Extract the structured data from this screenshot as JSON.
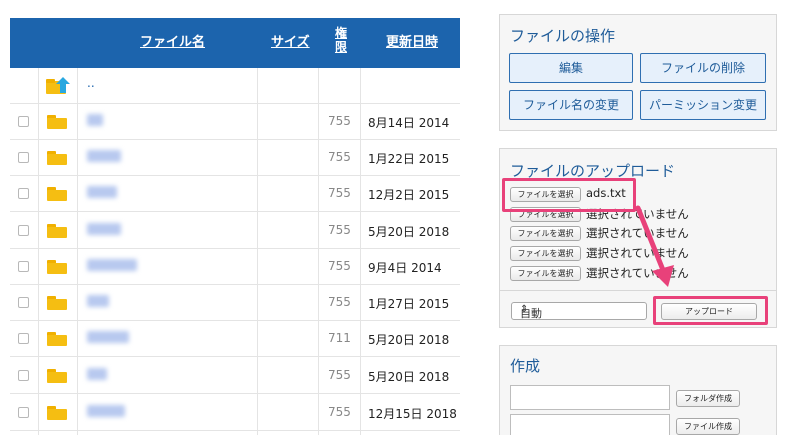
{
  "table": {
    "headers": {
      "name": "ファイル名",
      "size": "サイズ",
      "perm": "権限",
      "date": "更新日時"
    },
    "up_row_label": "..",
    "rows": [
      {
        "perm": "755",
        "date": "8月14日 2014"
      },
      {
        "perm": "755",
        "date": "1月22日 2015"
      },
      {
        "perm": "755",
        "date": "12月2日 2015"
      },
      {
        "perm": "755",
        "date": "5月20日 2018"
      },
      {
        "perm": "755",
        "date": "9月4日 2014"
      },
      {
        "perm": "755",
        "date": "1月27日 2015"
      },
      {
        "perm": "711",
        "date": "5月20日 2018"
      },
      {
        "perm": "755",
        "date": "5月20日 2018"
      },
      {
        "perm": "755",
        "date": "12月15日 2018"
      }
    ]
  },
  "file_ops": {
    "title": "ファイルの操作",
    "edit": "編集",
    "delete": "ファイルの削除",
    "rename": "ファイル名の変更",
    "permission": "パーミッション変更"
  },
  "upload": {
    "title": "ファイルのアップロード",
    "choose_label": "ファイルを選択",
    "files": [
      "ads.txt",
      "選択されていません",
      "選択されていません",
      "選択されていません",
      "選択されていません"
    ],
    "mode_select": "自動",
    "upload_button": "アップロード"
  },
  "create": {
    "title": "作成",
    "folder_button": "フォルダ作成",
    "file_button": "ファイル作成"
  },
  "colors": {
    "header_blue": "#1c64ad",
    "highlight": "#e8417a",
    "folder": "#f5be12"
  }
}
